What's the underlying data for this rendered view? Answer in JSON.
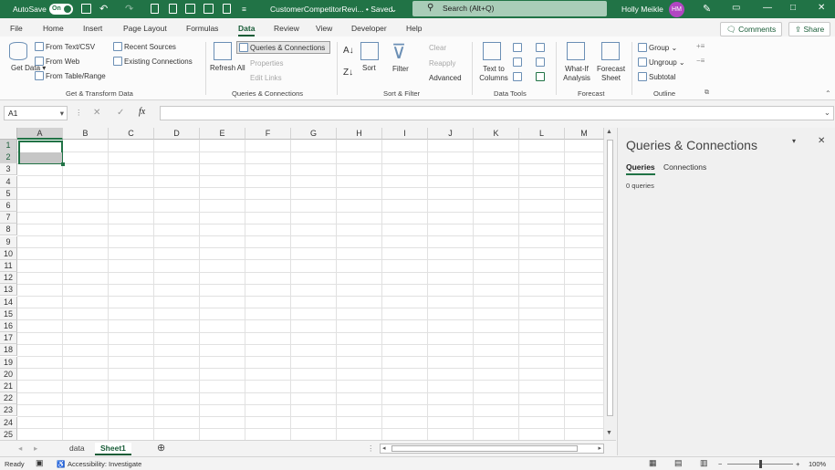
{
  "titlebar": {
    "autosave_label": "AutoSave",
    "autosave_state": "On",
    "document_title": "CustomerCompetitorRevi... • Saved",
    "search_placeholder": "Search (Alt+Q)",
    "user_name": "Holly Meikle",
    "user_initials": "HM"
  },
  "menu": {
    "tabs": [
      "File",
      "Home",
      "Insert",
      "Page Layout",
      "Formulas",
      "Data",
      "Review",
      "View",
      "Developer",
      "Help"
    ],
    "active_tab": "Data",
    "comments_label": "Comments",
    "share_label": "Share"
  },
  "ribbon": {
    "get_data": "Get Data",
    "from_text_csv": "From Text/CSV",
    "from_web": "From Web",
    "from_table_range": "From Table/Range",
    "recent_sources": "Recent Sources",
    "existing_connections": "Existing Connections",
    "group_get_transform": "Get & Transform Data",
    "refresh_all": "Refresh All",
    "queries_connections": "Queries & Connections",
    "properties": "Properties",
    "edit_links": "Edit Links",
    "group_queries": "Queries & Connections",
    "sort": "Sort",
    "filter": "Filter",
    "clear": "Clear",
    "reapply": "Reapply",
    "advanced": "Advanced",
    "group_sort_filter": "Sort & Filter",
    "text_to_columns": "Text to Columns",
    "group_data_tools": "Data Tools",
    "what_if": "What-If Analysis",
    "forecast_sheet": "Forecast Sheet",
    "group_forecast": "Forecast",
    "group_btn": "Group",
    "ungroup_btn": "Ungroup",
    "subtotal": "Subtotal",
    "group_outline": "Outline"
  },
  "formula_bar": {
    "name_box": "A1",
    "fx_label": "fx",
    "value": ""
  },
  "grid": {
    "columns": [
      "A",
      "B",
      "C",
      "D",
      "E",
      "F",
      "G",
      "H",
      "I",
      "J",
      "K",
      "L",
      "M"
    ],
    "rows": [
      "1",
      "2",
      "3",
      "4",
      "5",
      "6",
      "7",
      "8",
      "9",
      "10",
      "11",
      "12",
      "13",
      "14",
      "15",
      "16",
      "17",
      "18",
      "19",
      "20",
      "21",
      "22",
      "23",
      "24",
      "25"
    ]
  },
  "sheets": {
    "tabs": [
      "data",
      "Sheet1"
    ],
    "active": "Sheet1"
  },
  "panel": {
    "title": "Queries & Connections",
    "tab_queries": "Queries",
    "tab_connections": "Connections",
    "count_text": "0 queries"
  },
  "status": {
    "ready": "Ready",
    "accessibility": "Accessibility: Investigate",
    "zoom": "100%"
  }
}
